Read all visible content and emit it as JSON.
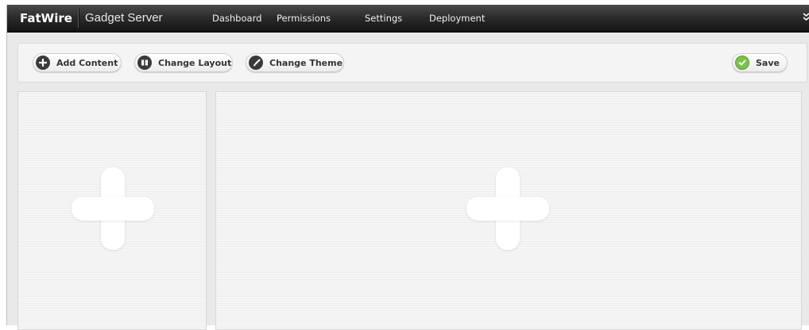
{
  "header": {
    "brand": "FatWire",
    "product": "Gadget Server",
    "nav": [
      {
        "label": "Dashboard"
      },
      {
        "label": "Permissions"
      },
      {
        "label": "Settings"
      },
      {
        "label": "Deployment"
      }
    ],
    "menu_icon": "chevron-down-icon"
  },
  "toolbar": {
    "add_content_label": "Add Content",
    "change_layout_label": "Change Layout",
    "change_theme_label": "Change Theme",
    "save_label": "Save",
    "icons": {
      "add_content": "plus-circle-icon",
      "change_layout": "columns-icon",
      "change_theme": "brush-icon",
      "save": "check-icon"
    }
  },
  "dashboard": {
    "columns": [
      {
        "name": "left-column",
        "placeholder_icon": "add-gadget-plus-icon"
      },
      {
        "name": "right-column",
        "placeholder_icon": "add-gadget-plus-icon"
      }
    ]
  },
  "colors": {
    "topbar": "#1f1f1f",
    "background": "#e9e9e9",
    "save_accent": "#7cc24a"
  }
}
